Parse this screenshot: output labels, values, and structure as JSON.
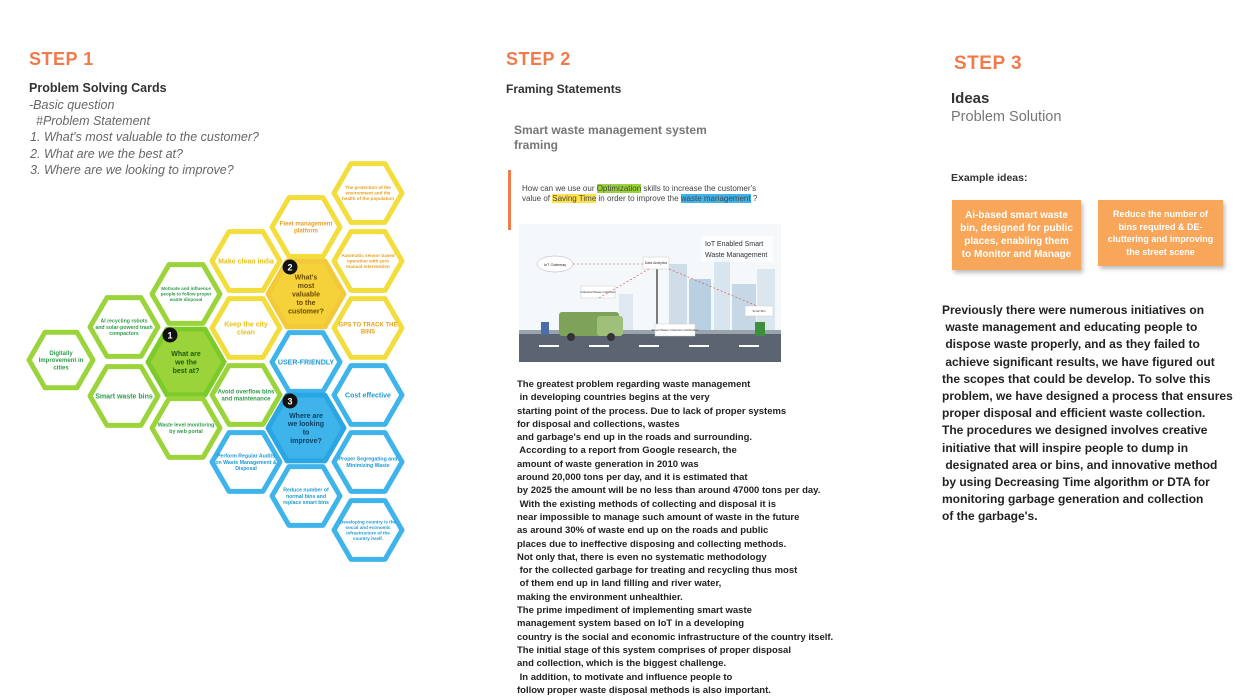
{
  "step1": {
    "label": "STEP 1",
    "title": "Problem Solving Cards",
    "basic": "-Basic question",
    "problem": "#Problem Statement",
    "questions": [
      "What's most valuable to the customer?",
      "What are we the best at?",
      "Where are we looking to improve?"
    ],
    "hexes": [
      {
        "text": "Digitally Improvement in cities",
        "color": "#9bd43a",
        "fill": "#ffffff",
        "tc": "#2e9d4a"
      },
      {
        "text": "AI recycling robots and solar-powerd trash compactors",
        "color": "#9bd43a",
        "fill": "#ffffff",
        "tc": "#2e9d4a"
      },
      {
        "text": "Smart waste bins",
        "color": "#9bd43a",
        "fill": "#ffffff",
        "tc": "#2e9d4a"
      },
      {
        "text": "Motivate and influence people to follow proper waste disposal",
        "color": "#9bd43a",
        "fill": "#ffffff",
        "tc": "#2e9d4a"
      },
      {
        "text": "What are we the best at?",
        "color": "#7ccb2a",
        "fill": "#9bd43a",
        "tc": "#1e5a12",
        "badge": "1"
      },
      {
        "text": "Waste level monitoring by web portal",
        "color": "#9bd43a",
        "fill": "#ffffff",
        "tc": "#2e9d4a"
      },
      {
        "text": "Make clean india",
        "color": "#f3dd3c",
        "fill": "#ffffff",
        "tc": "#e9c21b"
      },
      {
        "text": "Keep the city clean",
        "color": "#f3dd3c",
        "fill": "#ffffff",
        "tc": "#e9c21b"
      },
      {
        "text": "Avoid overflow bins and maintenance",
        "color": "#9bd43a",
        "fill": "#ffffff",
        "tc": "#2e9d4a"
      },
      {
        "text": "Fleet management platform",
        "color": "#f3dd3c",
        "fill": "#ffffff",
        "tc": "#e8a020"
      },
      {
        "text": "What's most valuable to the customer?",
        "color": "#f3c93a",
        "fill": "#f5d23a",
        "tc": "#6b4a00",
        "badge": "2"
      },
      {
        "text": "USER-FRIENDLY",
        "color": "#3fb4ea",
        "fill": "#ffffff",
        "tc": "#1e9ad6"
      },
      {
        "text": "Where are we looking to improve?",
        "color": "#2aa6e4",
        "fill": "#3fb4ea",
        "tc": "#0d3f66",
        "badge": "3"
      },
      {
        "text": "Perform Regular Audits on Waste Management & Disposal",
        "color": "#3fb4ea",
        "fill": "#ffffff",
        "tc": "#1e9ad6"
      },
      {
        "text": "Reduce number of normal bins and replace smart bins",
        "color": "#3fb4ea",
        "fill": "#ffffff",
        "tc": "#1e9ad6"
      },
      {
        "text": "The protection of the environment and the health of the population",
        "color": "#f3dd3c",
        "fill": "#ffffff",
        "tc": "#e8a020"
      },
      {
        "text": "Automatic sensor based operation with zero manual intervention",
        "color": "#f3dd3c",
        "fill": "#ffffff",
        "tc": "#e8a020"
      },
      {
        "text": "GPS TO TRACK THE BINS",
        "color": "#f3dd3c",
        "fill": "#ffffff",
        "tc": "#e8a020"
      },
      {
        "text": "Cost effective",
        "color": "#3fb4ea",
        "fill": "#ffffff",
        "tc": "#1e9ad6"
      },
      {
        "text": "Proper Segregating and Minimizing Waste",
        "color": "#3fb4ea",
        "fill": "#ffffff",
        "tc": "#1e9ad6"
      },
      {
        "text": "Developing country is the social and economic infrastructure of the country itself.",
        "color": "#3fb4ea",
        "fill": "#ffffff",
        "tc": "#1e9ad6"
      }
    ]
  },
  "step2": {
    "label": "STEP 2",
    "title": "Framing Statements",
    "frame_title": "Smart waste management system framing",
    "hmw": {
      "p1": "How can we use our ",
      "h1": "Optimization",
      "p2": " skills to increase the customer's value of ",
      "h2": "Saving Time",
      "p3": " in order to improve the ",
      "h3": "waste management",
      "p4": " ?"
    },
    "image_title": "IoT Enabled Smart Waste Management",
    "image_label_cloud": "IoT Gateway",
    "image_label_data": "Data Analytics",
    "image_label_a": "Industrial Waste Collection",
    "image_label_b": "Smart Waste Collection Notification",
    "image_label_c": "Smart Bin",
    "body_lines": [
      "The greatest problem regarding waste management",
      " in developing countries begins at the very",
      "starting point of the process. Due to lack of proper systems",
      "for disposal and collections, wastes",
      "and garbage's end up in the roads and surrounding.",
      " According to a report from Google research, the",
      "amount of waste generation in 2010 was",
      "around 20,000 tons per day, and it is estimated that",
      "by 2025 the amount will be no less than around 47000 tons per day.",
      " With the existing methods of collecting and disposal it is",
      "near impossible to manage such amount of waste in the future",
      "as around 30% of waste end up on the roads and public",
      "places due to ineffective disposing and collecting methods.",
      "Not only that, there is even no systematic methodology",
      " for the collected garbage for treating and recycling thus most",
      " of them end up in land filling and river water,",
      "making the environment unhealthier.",
      "The prime impediment of implementing smart waste",
      "management system based on IoT in a developing",
      "country is the social and economic infrastructure of the country itself.",
      "The initial stage of this system comprises of proper disposal",
      "and collection, which is the biggest challenge.",
      " In addition, to motivate and influence people to",
      "follow proper waste disposal methods is also important."
    ]
  },
  "step3": {
    "label": "STEP 3",
    "title": "Ideas",
    "subtitle": "Problem Solution",
    "example": "Example ideas:",
    "sticky1": "Ai-based smart waste bin, designed for public places, enabling them to Monitor and Manage",
    "sticky2": "Reduce the number of bins required & DE-cluttering and improving the street scene",
    "sticky_color": "#f7a65a",
    "sticky_text_color": "#ffffff",
    "body_lines": [
      "Previously there were numerous initiatives on",
      " waste management and educating people to",
      " dispose waste properly, and as they failed to",
      " achieve significant results, we have figured out",
      "the scopes that could be develop. To solve this",
      "problem, we have designed a process that ensures",
      "proper disposal and efficient waste collection.",
      "The procedures we designed involves creative",
      "initiative that will inspire people to dump in",
      " designated area or bins, and innovative method",
      "by using Decreasing Time algorithm or DTA for",
      "monitoring garbage generation and collection",
      "of the garbage's."
    ]
  }
}
